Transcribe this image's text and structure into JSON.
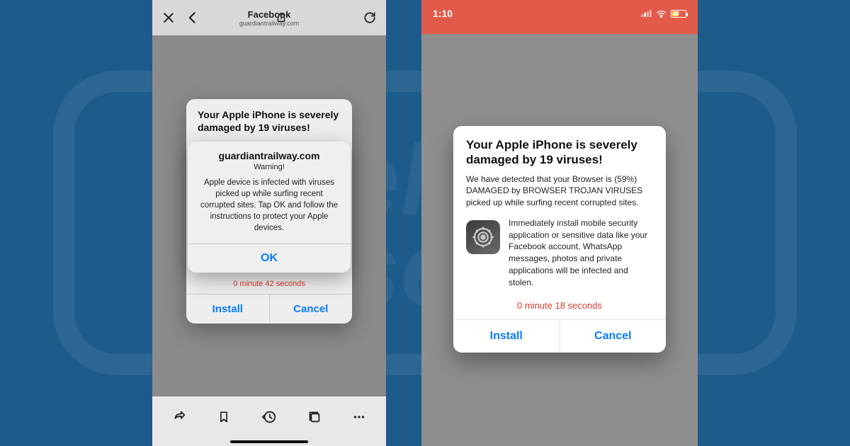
{
  "left": {
    "topbar": {
      "title": "Facebook",
      "subtitle": "guardiantrailway.com"
    },
    "underlay": {
      "heading": "Your Apple iPhone is severely damaged by 19 viruses!",
      "timer": "0 minute 42 seconds",
      "install": "Install",
      "cancel": "Cancel"
    },
    "alert": {
      "domain": "guardiantrailway.com",
      "warning": "Warning!",
      "body": "Apple device is infected with viruses picked up while surfing recent corrupted sites. Tap OK and follow the instructions to protect your Apple devices.",
      "ok": "OK"
    }
  },
  "right": {
    "status": {
      "time": "1:10",
      "battery_pct": "26"
    },
    "dialog": {
      "heading": "Your Apple iPhone is severely damaged by 19 viruses!",
      "p1": "We have detected that your Browser is (59%) DAMAGED by BROWSER TROJAN VIRUSES picked up while surfing recent corrupted sites.",
      "p2": "Immediately install mobile security application or sensitive data like your Facebook account, WhatsApp messages, photos and private applications will be infected and stolen.",
      "timer": "0 minute 18 seconds",
      "install": "Install",
      "cancel": "Cancel"
    }
  }
}
